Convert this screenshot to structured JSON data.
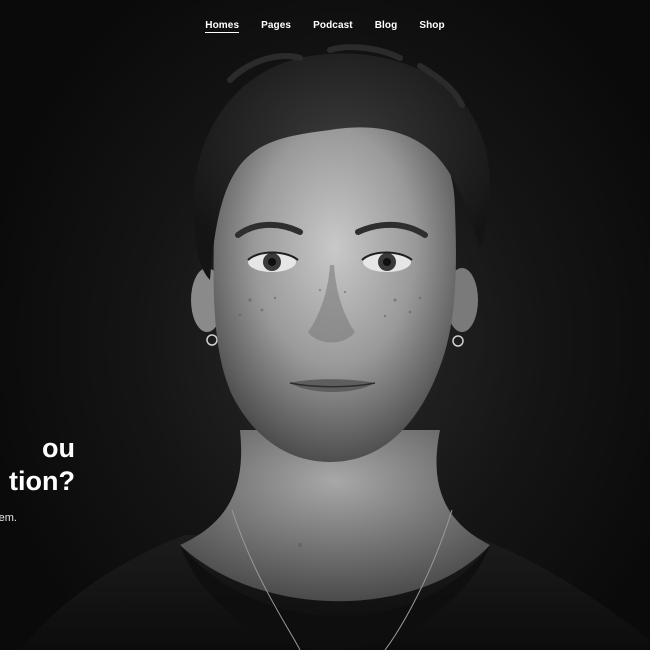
{
  "nav": {
    "items": [
      {
        "label": "Homes",
        "active": true
      },
      {
        "label": "Pages",
        "active": false
      },
      {
        "label": "Podcast",
        "active": false
      },
      {
        "label": "Blog",
        "active": false
      },
      {
        "label": "Shop",
        "active": false
      }
    ]
  },
  "hero": {
    "headline_line1": "ou",
    "headline_line2": "tion?",
    "subtext": "em.",
    "image": "black-and-white portrait photo",
    "colors": {
      "background": "#0b0b0b",
      "text": "#ffffff"
    }
  }
}
